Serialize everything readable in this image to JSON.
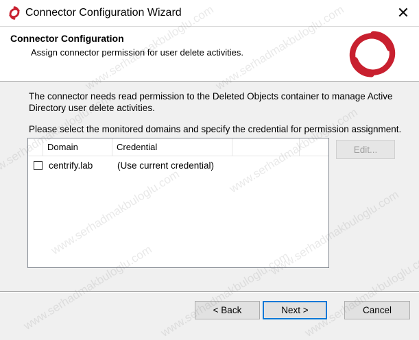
{
  "window": {
    "title": "Connector Configuration Wizard",
    "close_glyph": "✕",
    "icon": "centrify-logo-icon"
  },
  "header": {
    "title": "Connector Configuration",
    "subtitle": "Assign connector permission for user delete activities.",
    "logo": "centrify-logo-icon",
    "logo_color": "#c8202f"
  },
  "body": {
    "description": "The connector needs read permission to the Deleted Objects container to manage Active Directory user delete activities.",
    "instruction": "Please select the monitored domains and specify the credential for permission assignment."
  },
  "domain_list": {
    "columns": [
      "Domain",
      "Credential"
    ],
    "rows": [
      {
        "checked": false,
        "domain": "centrify.lab",
        "credential": "(Use current credential)"
      }
    ]
  },
  "buttons": {
    "edit": "Edit...",
    "back": "< Back",
    "next": "Next >",
    "cancel": "Cancel"
  },
  "watermark": {
    "text": "www.serhadmakbuloglu.com"
  }
}
